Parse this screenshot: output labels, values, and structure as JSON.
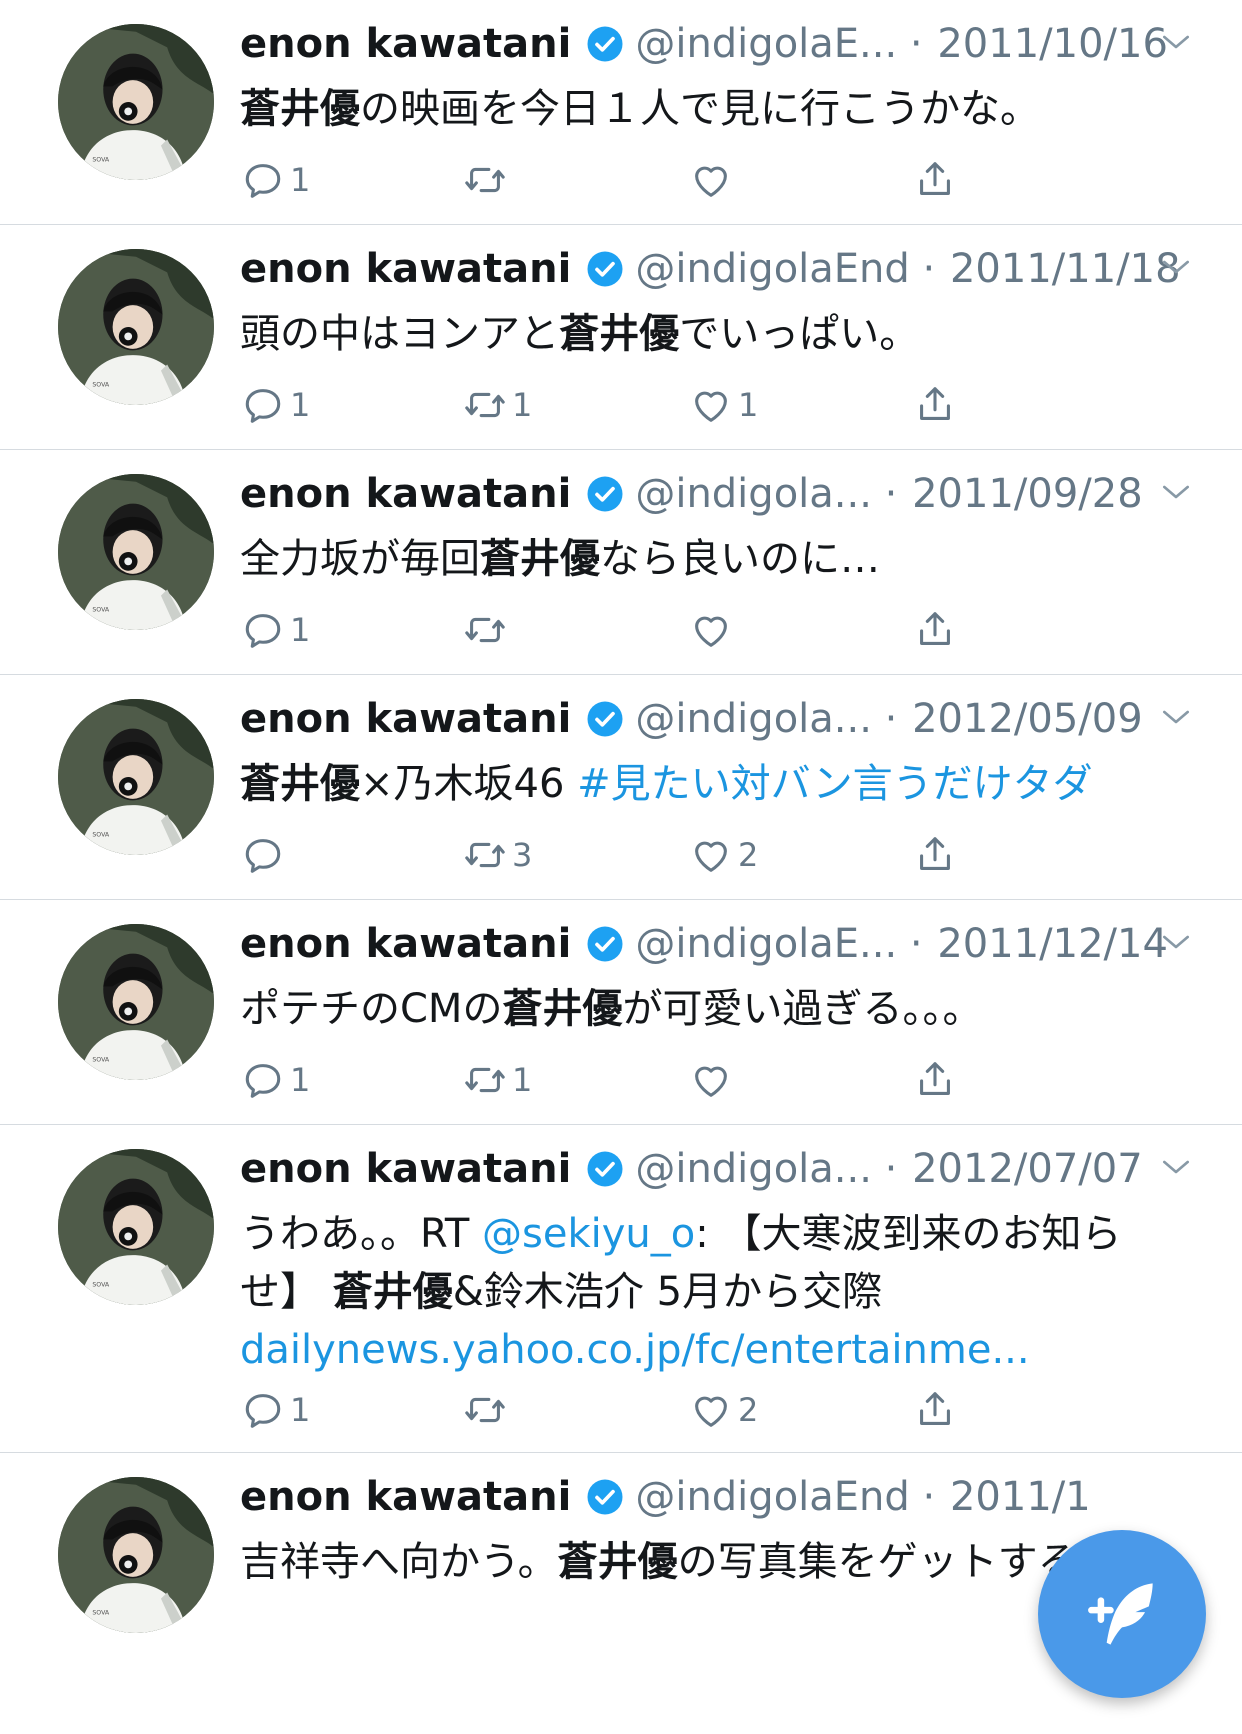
{
  "colors": {
    "accent": "#1b95e0",
    "text": "#14171a",
    "muted": "#657786",
    "fab": "#4a99e9"
  },
  "tweets": [
    {
      "name": "enon kawatani",
      "handle": "@indigolaE...",
      "sep": "·",
      "date": "2011/10/16",
      "text": [
        {
          "t": "蒼井優",
          "bold": true
        },
        {
          "t": "の映画を今日１人で見に行こうかな。"
        }
      ],
      "reply": "1",
      "retweet": "",
      "like": ""
    },
    {
      "name": "enon kawatani",
      "handle": "@indigolaEnd",
      "sep": "·",
      "date": "2011/11/18",
      "text": [
        {
          "t": "頭の中はヨンアと"
        },
        {
          "t": "蒼井優",
          "bold": true
        },
        {
          "t": "でいっぱい。"
        }
      ],
      "reply": "1",
      "retweet": "1",
      "like": "1"
    },
    {
      "name": "enon kawatani",
      "handle": "@indigola...",
      "sep": "·",
      "date": "2011/09/28",
      "text": [
        {
          "t": "全力坂が毎回"
        },
        {
          "t": "蒼井優",
          "bold": true
        },
        {
          "t": "なら良いのに…"
        }
      ],
      "reply": "1",
      "retweet": "",
      "like": ""
    },
    {
      "name": "enon kawatani",
      "handle": "@indigola...",
      "sep": "·",
      "date": "2012/05/09",
      "text": [
        {
          "t": "蒼井優",
          "bold": true
        },
        {
          "t": "×乃木坂46 "
        },
        {
          "t": "#見たい対バン言うだけタダ",
          "link": true
        }
      ],
      "reply": "",
      "retweet": "3",
      "like": "2"
    },
    {
      "name": "enon kawatani",
      "handle": "@indigolaE...",
      "sep": "·",
      "date": "2011/12/14",
      "text": [
        {
          "t": "ポテチのCMの"
        },
        {
          "t": "蒼井優",
          "bold": true
        },
        {
          "t": "が可愛い過ぎる。。。"
        }
      ],
      "reply": "1",
      "retweet": "1",
      "like": ""
    },
    {
      "name": "enon kawatani",
      "handle": "@indigola...",
      "sep": "·",
      "date": "2012/07/07",
      "lines": [
        [
          {
            "t": "うわあ。。RT "
          },
          {
            "t": "@sekiyu_o",
            "link": true
          },
          {
            "t": ": 【大寒波到来のお知ら"
          }
        ],
        [
          {
            "t": "せ】 "
          },
          {
            "t": "蒼井優",
            "bold": true
          },
          {
            "t": "&鈴木浩介 5月から交際"
          }
        ],
        [
          {
            "t": "dailynews.yahoo.co.jp/fc/entertainme...",
            "link": true
          }
        ]
      ],
      "reply": "1",
      "retweet": "",
      "like": "2"
    },
    {
      "name": "enon kawatani",
      "handle": "@indigolaEnd",
      "sep": "·",
      "date": "2011/1",
      "text": [
        {
          "t": "吉祥寺へ向かう。"
        },
        {
          "t": "蒼井優",
          "bold": true
        },
        {
          "t": "の写真集をゲットするた"
        }
      ],
      "reply": "",
      "retweet": "",
      "like": ""
    }
  ],
  "compose": {
    "icon": "compose-feather-icon"
  }
}
